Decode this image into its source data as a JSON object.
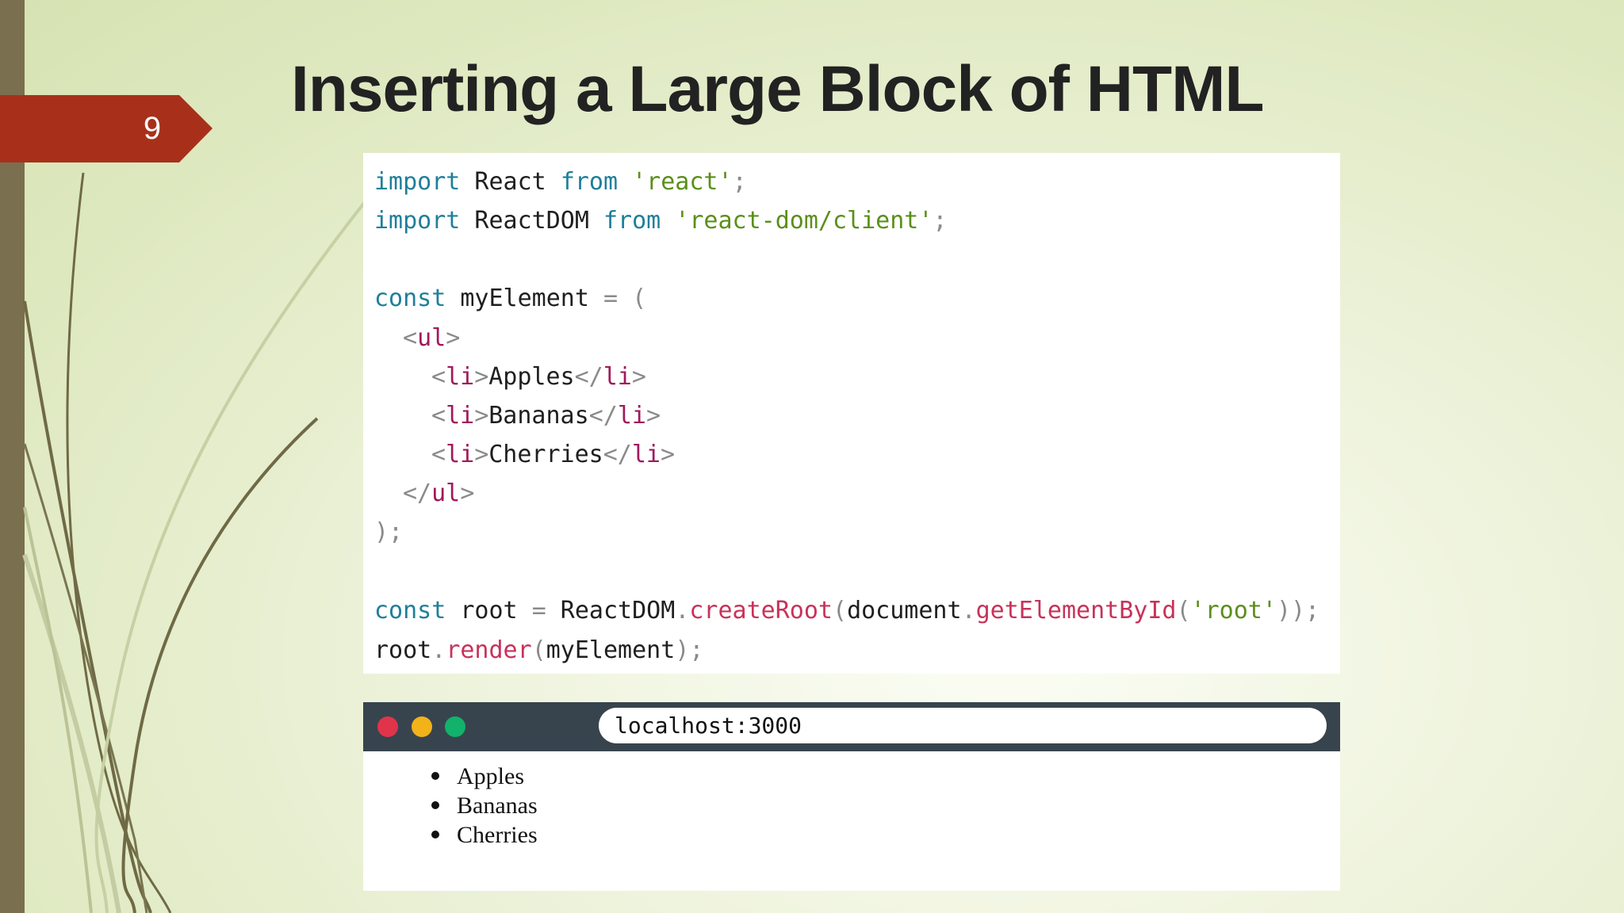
{
  "slide": {
    "number": "9",
    "title": "Inserting a Large Block of HTML",
    "accent_color": "#a8301a"
  },
  "code": {
    "line1": {
      "kw1": "import",
      "name": " React ",
      "kw2": "from",
      "space": " ",
      "str": "'react'",
      "end": ";"
    },
    "line2": {
      "kw1": "import",
      "name": " ReactDOM ",
      "kw2": "from",
      "space": " ",
      "str": "'react-dom/client'",
      "end": ";"
    },
    "line4": {
      "kw": "const",
      "name": " myElement ",
      "op": "= ("
    },
    "line5": {
      "open": "<",
      "tag": "ul",
      "close": ">"
    },
    "items": [
      {
        "open": "<",
        "tag": "li",
        "mid": ">",
        "text": "Apples",
        "close_open": "</",
        "close_tag": "li",
        "close": ">"
      },
      {
        "open": "<",
        "tag": "li",
        "mid": ">",
        "text": "Bananas",
        "close_open": "</",
        "close_tag": "li",
        "close": ">"
      },
      {
        "open": "<",
        "tag": "li",
        "mid": ">",
        "text": "Cherries",
        "close_open": "</",
        "close_tag": "li",
        "close": ">"
      }
    ],
    "line9": {
      "open": "</",
      "tag": "ul",
      "close": ">"
    },
    "line10": {
      "text": ");"
    },
    "line12": {
      "kw": "const",
      "name": " root ",
      "eq": "=",
      "obj": " ReactDOM",
      "dot1": ".",
      "fn1": "createRoot",
      "paren1": "(",
      "doc": "document",
      "dot2": ".",
      "fn2": "getElementById",
      "paren2": "(",
      "str": "'root'",
      "end": "));"
    },
    "line13": {
      "obj": "root",
      "dot": ".",
      "fn": "render",
      "paren": "(",
      "arg": "myElement",
      "end": ");"
    }
  },
  "browser": {
    "url": "localhost:3000",
    "list": [
      "Apples",
      "Bananas",
      "Cherries"
    ],
    "colors": {
      "bar": "#37444e",
      "red": "#e0344b",
      "yellow": "#f2b21a",
      "green": "#12b26b"
    }
  }
}
